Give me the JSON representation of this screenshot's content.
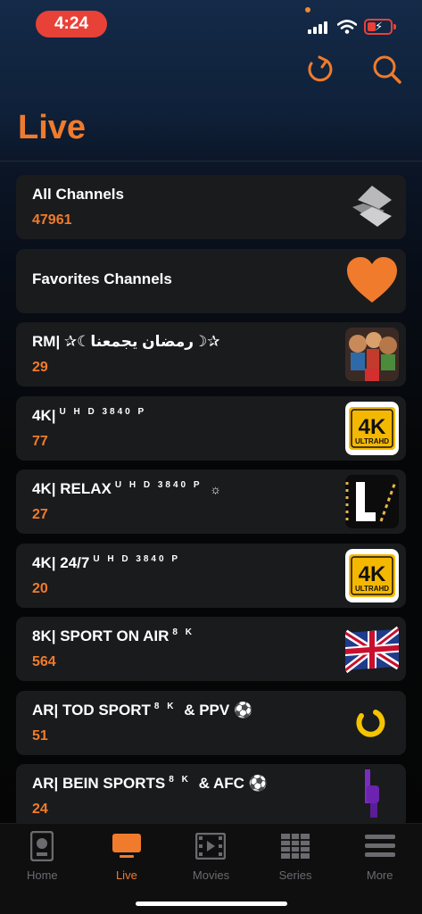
{
  "status": {
    "time": "4:24"
  },
  "header": {
    "title": "Live",
    "refresh_icon": "refresh-icon",
    "search_icon": "search-icon"
  },
  "colors": {
    "accent": "#f07b2c",
    "card": "#1a1b1d",
    "time_pill": "#e84138"
  },
  "categories": [
    {
      "name": "All Channels",
      "sup": "",
      "extra": "",
      "count": "47961",
      "logo": "swirl-logo"
    },
    {
      "name": "Favorites Channels",
      "sup": "",
      "extra": "",
      "count": "",
      "logo": "heart-icon"
    },
    {
      "name": "RM| ✰☾رمضان يجمعنا☽✰",
      "sup": "",
      "extra": "",
      "count": "29",
      "logo": "ramadan-artwork"
    },
    {
      "name": "4K|",
      "sup": "U H D 3840 P",
      "extra": "",
      "count": "77",
      "logo": "4k-ultrahd-logo"
    },
    {
      "name": "4K| RELAX",
      "sup": "U H D 3840 P",
      "extra": "☼",
      "count": "27",
      "logo": "relax-logo"
    },
    {
      "name": "4K| 24/7",
      "sup": "U H D 3840 P",
      "extra": "",
      "count": "20",
      "logo": "4k-ultrahd-logo"
    },
    {
      "name": "8K| SPORT ON AIR",
      "sup": "8 K",
      "extra": "",
      "count": "564",
      "logo": "uk-flag"
    },
    {
      "name": "AR| TOD SPORT",
      "sup": "8 K",
      "extra": "& PPV ⚽",
      "count": "51",
      "logo": "tod-logo"
    },
    {
      "name": "AR| BEIN SPORTS",
      "sup": "8 K",
      "extra": "& AFC ⚽",
      "count": "24",
      "logo": "bein-logo"
    }
  ],
  "tabs": [
    {
      "label": "Home",
      "icon": "home-icon",
      "active": false
    },
    {
      "label": "Live",
      "icon": "tv-icon",
      "active": true
    },
    {
      "label": "Movies",
      "icon": "film-icon",
      "active": false
    },
    {
      "label": "Series",
      "icon": "series-grid-icon",
      "active": false
    },
    {
      "label": "More",
      "icon": "menu-icon",
      "active": false
    }
  ]
}
